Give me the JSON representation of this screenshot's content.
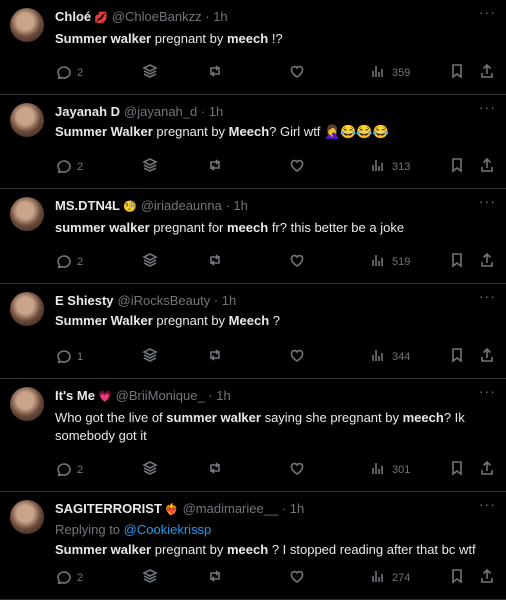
{
  "tweets": [
    {
      "name": "Chloé",
      "emoji": "💋",
      "handle": "@ChloeBankzz",
      "time": "1h",
      "segments": [
        [
          "b",
          "Summer walker"
        ],
        [
          "t",
          " pregnant by "
        ],
        [
          "b",
          "meech"
        ],
        [
          "t",
          " !?"
        ]
      ],
      "reply_count": "2",
      "views": "359"
    },
    {
      "name": "Jayanah D",
      "emoji": "",
      "handle": "@jayanah_d",
      "time": "1h",
      "segments": [
        [
          "b",
          "Summer Walker"
        ],
        [
          "t",
          " pregnant by "
        ],
        [
          "b",
          "Meech"
        ],
        [
          "t",
          "? Girl wtf 🤦‍♀️😂😂😂"
        ]
      ],
      "reply_count": "2",
      "views": "313"
    },
    {
      "name": "MS.DTN4L",
      "emoji": "🧐",
      "handle": "@iriadeaunna",
      "time": "1h",
      "segments": [
        [
          "b",
          "summer walker"
        ],
        [
          "t",
          " pregnant for "
        ],
        [
          "b",
          "meech"
        ],
        [
          "t",
          " fr? this better be a joke"
        ]
      ],
      "reply_count": "2",
      "views": "519"
    },
    {
      "name": "E Shiesty",
      "emoji": "",
      "handle": "@iRocksBeauty",
      "time": "1h",
      "segments": [
        [
          "b",
          "Summer Walker"
        ],
        [
          "t",
          " pregnant by "
        ],
        [
          "b",
          "Meech"
        ],
        [
          "t",
          " ?"
        ]
      ],
      "reply_count": "1",
      "views": "344"
    },
    {
      "name": "It's Me",
      "emoji": "💗",
      "handle": "@BriiMonique_",
      "time": "1h",
      "segments": [
        [
          "t",
          "Who got the live of "
        ],
        [
          "b",
          "summer walker"
        ],
        [
          "t",
          " saying she pregnant by "
        ],
        [
          "b",
          "meech"
        ],
        [
          "t",
          "? Ik somebody got it"
        ]
      ],
      "reply_count": "2",
      "views": "301"
    },
    {
      "name": "SAGITERRORIST",
      "emoji": "❤️‍🔥",
      "handle": "@madimariee__",
      "time": "1h",
      "reply_prefix": "Replying to ",
      "reply_user": "@Cookiekrissp",
      "segments": [
        [
          "b",
          "Summer walker"
        ],
        [
          "t",
          " pregnant by "
        ],
        [
          "b",
          "meech"
        ],
        [
          "t",
          " ? I stopped reading after that bc wtf"
        ]
      ],
      "reply_count": "2",
      "views": "274"
    }
  ],
  "icons": [
    "more-icon",
    "reply-icon",
    "stack-icon",
    "retweet-icon",
    "like-icon",
    "views-icon",
    "bookmark-icon",
    "share-icon"
  ],
  "dot": "·",
  "more": "···"
}
